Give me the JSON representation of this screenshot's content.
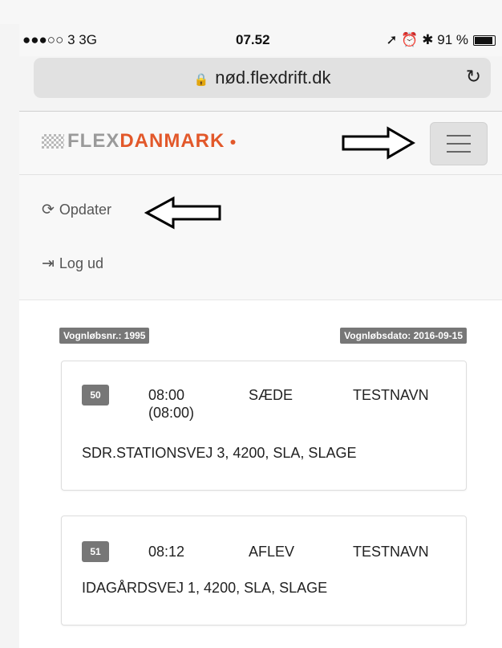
{
  "status_bar": {
    "carrier": "●●●○○ 3  3G",
    "time": "07.52",
    "indicators": "➚ ⏰ ✱ 91 %",
    "battery_percent": 91
  },
  "browser": {
    "url": "nød.flexdrift.dk",
    "lock_icon": "lock-icon",
    "reload_icon": "reload-icon"
  },
  "navbar": {
    "logo_flex": "FLEX",
    "logo_danmark": "DANMARK",
    "logo_dot": "●",
    "menu_icon": "hamburger-icon"
  },
  "menu": {
    "refresh_icon": "refresh-icon",
    "refresh_label": "Opdater",
    "logout_icon": "logout-icon",
    "logout_label": "Log ud"
  },
  "route": {
    "number_label": "Vognløbsnr.: 1995",
    "date_label": "Vognløbsdato: 2016-09-15"
  },
  "stops": [
    {
      "number": "50",
      "time": "08:00",
      "time_sub": "(08:00)",
      "type": "SÆDE",
      "name": "TESTNAVN",
      "address": "SDR.STATIONSVEJ 3, 4200, SLA, SLAGE"
    },
    {
      "number": "51",
      "time": "08:12",
      "time_sub": "",
      "type": "AFLEV",
      "name": "TESTNAVN",
      "address": "IDAGÅRDSVEJ 1, 4200, SLA, SLAGE"
    }
  ],
  "colors": {
    "brand_orange": "#e2582a",
    "brand_gray": "#9a9a9a",
    "badge_gray": "#777777"
  }
}
